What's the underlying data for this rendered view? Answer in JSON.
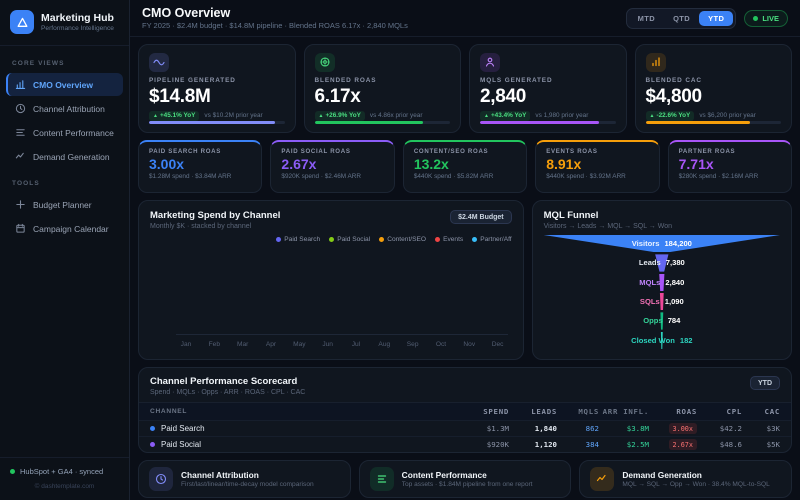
{
  "sidebar": {
    "brand": {
      "name": "Marketing Hub",
      "tagline": "Performance Intelligence"
    },
    "sections": [
      {
        "label": "CORE VIEWS",
        "items": [
          {
            "label": "CMO Overview",
            "active": true
          },
          {
            "label": "Channel Attribution"
          },
          {
            "label": "Content Performance"
          },
          {
            "label": "Demand Generation"
          }
        ]
      },
      {
        "label": "TOOLS",
        "items": [
          {
            "label": "Budget Planner"
          },
          {
            "label": "Campaign Calendar"
          }
        ]
      }
    ],
    "sync_status": "HubSpot + GA4 · synced",
    "copyright": "© dashtemplate.com"
  },
  "header": {
    "title": "CMO Overview",
    "subtitle": "FY 2025 · $2.4M budget · $14.8M pipeline · Blended ROAS 6.17x · 2,840 MQLs",
    "ranges": {
      "mtd": "MTD",
      "qtd": "QTD",
      "ytd": "YTD"
    },
    "active_range": "YTD",
    "live_label": "LIVE"
  },
  "kpis": [
    {
      "label": "PIPELINE GENERATED",
      "value": "$14.8M",
      "delta": "+45.1% YoY",
      "compare": "vs $10.2M prior year",
      "color": "#818cf8",
      "progress": "93%"
    },
    {
      "label": "BLENDED ROAS",
      "value": "6.17x",
      "delta": "+26.9% YoY",
      "compare": "vs 4.86x prior year",
      "color": "#22c55e",
      "progress": "80%"
    },
    {
      "label": "MQLS GENERATED",
      "value": "2,840",
      "delta": "+43.4% YoY",
      "compare": "vs 1,980 prior year",
      "color": "#a855f7",
      "progress": "88%"
    },
    {
      "label": "BLENDED CAC",
      "value": "$4,800",
      "delta": "-22.6% YoY",
      "compare": "vs $6,200 prior year",
      "color": "#f59e0b",
      "progress": "77%"
    }
  ],
  "roas_cards": [
    {
      "label": "PAID SEARCH ROAS",
      "value": "3.00x",
      "sub": "$1.28M spend · $3.84M ARR",
      "color": "#3b82f6"
    },
    {
      "label": "PAID SOCIAL ROAS",
      "value": "2.67x",
      "sub": "$920K spend · $2.46M ARR",
      "color": "#8b5cf6"
    },
    {
      "label": "CONTENT/SEO ROAS",
      "value": "13.2x",
      "sub": "$440K spend · $5.82M ARR",
      "color": "#22c55e"
    },
    {
      "label": "EVENTS ROAS",
      "value": "8.91x",
      "sub": "$440K spend · $3.92M ARR",
      "color": "#f59e0b"
    },
    {
      "label": "PARTNER ROAS",
      "value": "7.71x",
      "sub": "$280K spend · $2.16M ARR",
      "color": "#a855f7"
    }
  ],
  "spend_chart": {
    "title": "Marketing Spend by Channel",
    "subtitle": "Monthly $K · stacked by channel",
    "budget_badge": "$2.4M Budget",
    "legend": [
      {
        "label": "Paid Search",
        "color": "#6366f1"
      },
      {
        "label": "Paid Social",
        "color": "#84cc16"
      },
      {
        "label": "Content/SEO",
        "color": "#f59e0b"
      },
      {
        "label": "Events",
        "color": "#ef4444"
      },
      {
        "label": "Partner/Aff",
        "color": "#38bdf8"
      }
    ],
    "months": [
      "Jan",
      "Feb",
      "Mar",
      "Apr",
      "May",
      "Jun",
      "Jul",
      "Aug",
      "Sep",
      "Oct",
      "Nov",
      "Dec"
    ]
  },
  "funnel": {
    "title": "MQL Funnel",
    "subtitle": "Visitors → Leads → MQL → SQL → Won",
    "stages": [
      {
        "label": "Visitors",
        "value": "184,200",
        "color": "#3b82f6",
        "name_color": "#eaf2ff"
      },
      {
        "label": "Leads",
        "value": "7,380",
        "color": "#6366f1",
        "name_color": "#e2e8f0"
      },
      {
        "label": "MQLs",
        "value": "2,840",
        "color": "#a855f7",
        "name_color": "#c084fc"
      },
      {
        "label": "SQLs",
        "value": "1,090",
        "color": "#ec4899",
        "name_color": "#f472b6"
      },
      {
        "label": "Opps",
        "value": "784",
        "color": "#10b981",
        "name_color": "#34d399"
      },
      {
        "label": "Closed Won",
        "value": "182",
        "color": "#2dd4bf",
        "name_color": "#2dd4bf"
      }
    ]
  },
  "scorecard": {
    "title": "Channel Performance Scorecard",
    "subtitle": "Spend · MQLs · Opps · ARR · ROAS · CPL · CAC",
    "badge": "YTD",
    "columns": [
      "CHANNEL",
      "SPEND",
      "LEADS",
      "MQLS",
      "ARR INFL.",
      "ROAS",
      "CPL",
      "CAC"
    ],
    "rows": [
      {
        "channel": "Paid Search",
        "dot_color": "#3b82f6",
        "spend": "$1.3M",
        "leads": "1,840",
        "mqls": "862",
        "arr": "$3.8M",
        "roas": "3.00x",
        "cpl": "$42.2",
        "cac": "$3K"
      },
      {
        "channel": "Paid Social",
        "dot_color": "#8b5cf6",
        "spend": "$920K",
        "leads": "1,120",
        "mqls": "384",
        "arr": "$2.5M",
        "roas": "2.67x",
        "cpl": "$48.6",
        "cac": "$5K"
      }
    ]
  },
  "quick_links": [
    {
      "title": "Channel Attribution",
      "subtitle": "First/last/linear/time-decay model comparison"
    },
    {
      "title": "Content Performance",
      "subtitle": "Top assets · $1.84M pipeline from one report"
    },
    {
      "title": "Demand Generation",
      "subtitle": "MQL → SQL → Opp → Won · 38.4% MQL-to-SQL"
    }
  ]
}
